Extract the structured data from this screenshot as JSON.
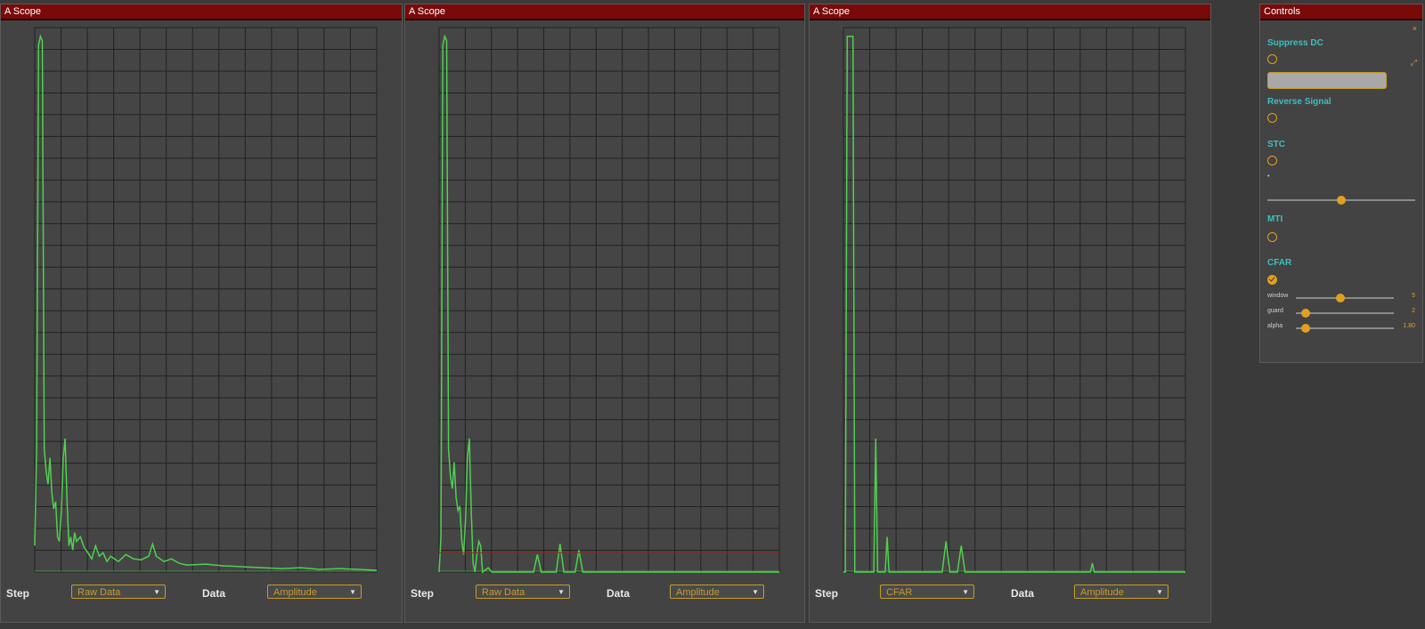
{
  "panels": [
    {
      "title": "A Scope",
      "step_label": "Step",
      "step_value": "Raw Data",
      "data_label": "Data",
      "data_value": "Amplitude"
    },
    {
      "title": "A Scope",
      "step_label": "Step",
      "step_value": "Raw Data",
      "data_label": "Data",
      "data_value": "Amplitude"
    },
    {
      "title": "A Scope",
      "step_label": "Step",
      "step_value": "CFAR",
      "data_label": "Data",
      "data_value": "Amplitude"
    }
  ],
  "controls": {
    "title": "Controls",
    "suppress_dc": {
      "label": "Suppress DC",
      "checked": false
    },
    "reverse_signal": {
      "label": "Reverse Signal",
      "checked": false
    },
    "stc": {
      "label": "STC",
      "checked": false,
      "slider_fraction": 0.5
    },
    "mti": {
      "label": "MTI",
      "checked": false
    },
    "cfar": {
      "label": "CFAR",
      "checked": true
    },
    "sliders": [
      {
        "label": "window",
        "value": "5",
        "fraction": 0.45
      },
      {
        "label": "guard",
        "value": "2",
        "fraction": 0.1
      },
      {
        "label": "alpha",
        "value": "1.80",
        "fraction": 0.1
      }
    ]
  },
  "colors": {
    "title_bg": "#7a0a0a",
    "signal": "#4fd04f",
    "accent": "#e0a020",
    "threshold": "#8a2a1a",
    "label_teal": "#3fbfbf"
  },
  "chart_data": [
    {
      "type": "line",
      "series": [
        {
          "values": [
            [
              0.0,
              30
            ],
            [
              0.05,
              140
            ],
            [
              0.1,
              600
            ],
            [
              0.15,
              610
            ],
            [
              0.2,
              605
            ],
            [
              0.25,
              140
            ],
            [
              0.3,
              115
            ],
            [
              0.35,
              100
            ],
            [
              0.4,
              130
            ],
            [
              0.45,
              90
            ],
            [
              0.5,
              72
            ],
            [
              0.55,
              80
            ],
            [
              0.6,
              40
            ],
            [
              0.65,
              35
            ],
            [
              0.7,
              70
            ],
            [
              0.75,
              130
            ],
            [
              0.8,
              152
            ],
            [
              0.85,
              80
            ],
            [
              0.9,
              30
            ],
            [
              0.95,
              40
            ],
            [
              1.0,
              25
            ],
            [
              1.05,
              45
            ],
            [
              1.1,
              35
            ],
            [
              1.2,
              40
            ],
            [
              1.3,
              28
            ],
            [
              1.4,
              22
            ],
            [
              1.5,
              15
            ],
            [
              1.6,
              30
            ],
            [
              1.7,
              18
            ],
            [
              1.8,
              22
            ],
            [
              1.9,
              12
            ],
            [
              2.0,
              18
            ],
            [
              2.2,
              12
            ],
            [
              2.4,
              20
            ],
            [
              2.6,
              15
            ],
            [
              2.8,
              14
            ],
            [
              3.0,
              18
            ],
            [
              3.1,
              32
            ],
            [
              3.2,
              18
            ],
            [
              3.4,
              12
            ],
            [
              3.6,
              15
            ],
            [
              3.8,
              10
            ],
            [
              4.0,
              8
            ],
            [
              4.5,
              9
            ],
            [
              5.0,
              7
            ],
            [
              5.5,
              6
            ],
            [
              6.0,
              5
            ],
            [
              6.5,
              4
            ],
            [
              7.0,
              5
            ],
            [
              7.5,
              3
            ],
            [
              8.0,
              4
            ],
            [
              8.5,
              3
            ],
            [
              9.0,
              2
            ]
          ]
        }
      ]
    },
    {
      "type": "line",
      "series": [
        {
          "values": [
            [
              0.0,
              0
            ],
            [
              0.05,
              40
            ],
            [
              0.1,
              600
            ],
            [
              0.15,
              610
            ],
            [
              0.2,
              605
            ],
            [
              0.25,
              140
            ],
            [
              0.3,
              110
            ],
            [
              0.35,
              95
            ],
            [
              0.4,
              125
            ],
            [
              0.45,
              85
            ],
            [
              0.5,
              70
            ],
            [
              0.55,
              75
            ],
            [
              0.6,
              35
            ],
            [
              0.65,
              20
            ],
            [
              0.7,
              60
            ],
            [
              0.75,
              130
            ],
            [
              0.8,
              152
            ],
            [
              0.85,
              70
            ],
            [
              0.9,
              10
            ],
            [
              0.95,
              0
            ],
            [
              1.0,
              20
            ],
            [
              1.05,
              35
            ],
            [
              1.1,
              30
            ],
            [
              1.15,
              0
            ],
            [
              1.3,
              5
            ],
            [
              1.4,
              0
            ],
            [
              2.5,
              0
            ],
            [
              2.6,
              20
            ],
            [
              2.7,
              0
            ],
            [
              3.1,
              0
            ],
            [
              3.2,
              32
            ],
            [
              3.3,
              0
            ],
            [
              3.6,
              0
            ],
            [
              3.7,
              25
            ],
            [
              3.8,
              0
            ],
            [
              9.0,
              0
            ]
          ]
        },
        {
          "values": [
            [
              0.0,
              22
            ],
            [
              9.0,
              22
            ]
          ]
        }
      ]
    },
    {
      "type": "line",
      "series": [
        {
          "values": [
            [
              0.0,
              0
            ],
            [
              0.05,
              0
            ],
            [
              0.1,
              610
            ],
            [
              0.15,
              610
            ],
            [
              0.2,
              610
            ],
            [
              0.25,
              610
            ],
            [
              0.3,
              0
            ],
            [
              0.8,
              0
            ],
            [
              0.85,
              152
            ],
            [
              0.9,
              0
            ],
            [
              1.1,
              0
            ],
            [
              1.15,
              40
            ],
            [
              1.2,
              0
            ],
            [
              2.6,
              0
            ],
            [
              2.7,
              35
            ],
            [
              2.8,
              0
            ],
            [
              3.0,
              0
            ],
            [
              3.1,
              30
            ],
            [
              3.2,
              0
            ],
            [
              6.5,
              0
            ],
            [
              6.55,
              10
            ],
            [
              6.6,
              0
            ],
            [
              9.0,
              0
            ]
          ]
        }
      ]
    }
  ]
}
